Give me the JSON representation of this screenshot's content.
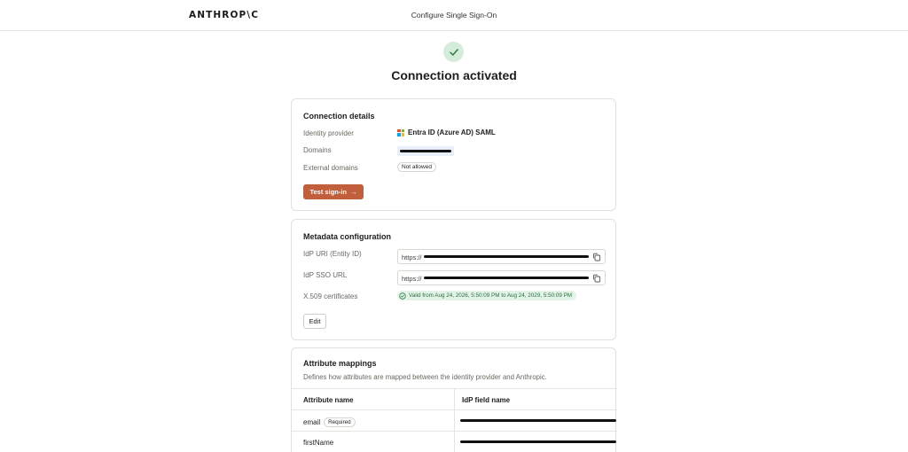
{
  "header": {
    "logo": "ANTHROP\\C",
    "title": "Configure Single Sign-On"
  },
  "status": {
    "heading": "Connection activated",
    "icon": "check-icon",
    "color": "#2f7a45"
  },
  "connection_details": {
    "title": "Connection details",
    "identity_provider_label": "Identity provider",
    "identity_provider_value": "Entra ID (Azure AD) SAML",
    "domains_label": "Domains",
    "external_domains_label": "External domains",
    "external_domains_value": "Not allowed",
    "test_button_label": "Test sign-in",
    "test_button_arrow": "→"
  },
  "metadata": {
    "title": "Metadata configuration",
    "idp_uri_label": "IdP URI (Entity ID)",
    "idp_uri_prefix": "https://",
    "idp_sso_label": "IdP SSO URL",
    "idp_sso_prefix": "https://",
    "cert_label": "X.509 certificates",
    "cert_value": "Valid from Aug 24, 2026, 5:50:09 PM to Aug 24, 2029, 5:50:09 PM",
    "edit_label": "Edit"
  },
  "attributes": {
    "title": "Attribute mappings",
    "description": "Defines how attributes are mapped between the identity provider and Anthropic.",
    "col_attribute": "Attribute name",
    "col_field": "IdP field name",
    "rows": [
      {
        "name": "email",
        "badge": "Required"
      },
      {
        "name": "firstName",
        "badge": ""
      }
    ]
  },
  "colors": {
    "accent": "#c15f3c",
    "success_bg": "#e3f3e7",
    "success_text": "#2b6e3f"
  }
}
